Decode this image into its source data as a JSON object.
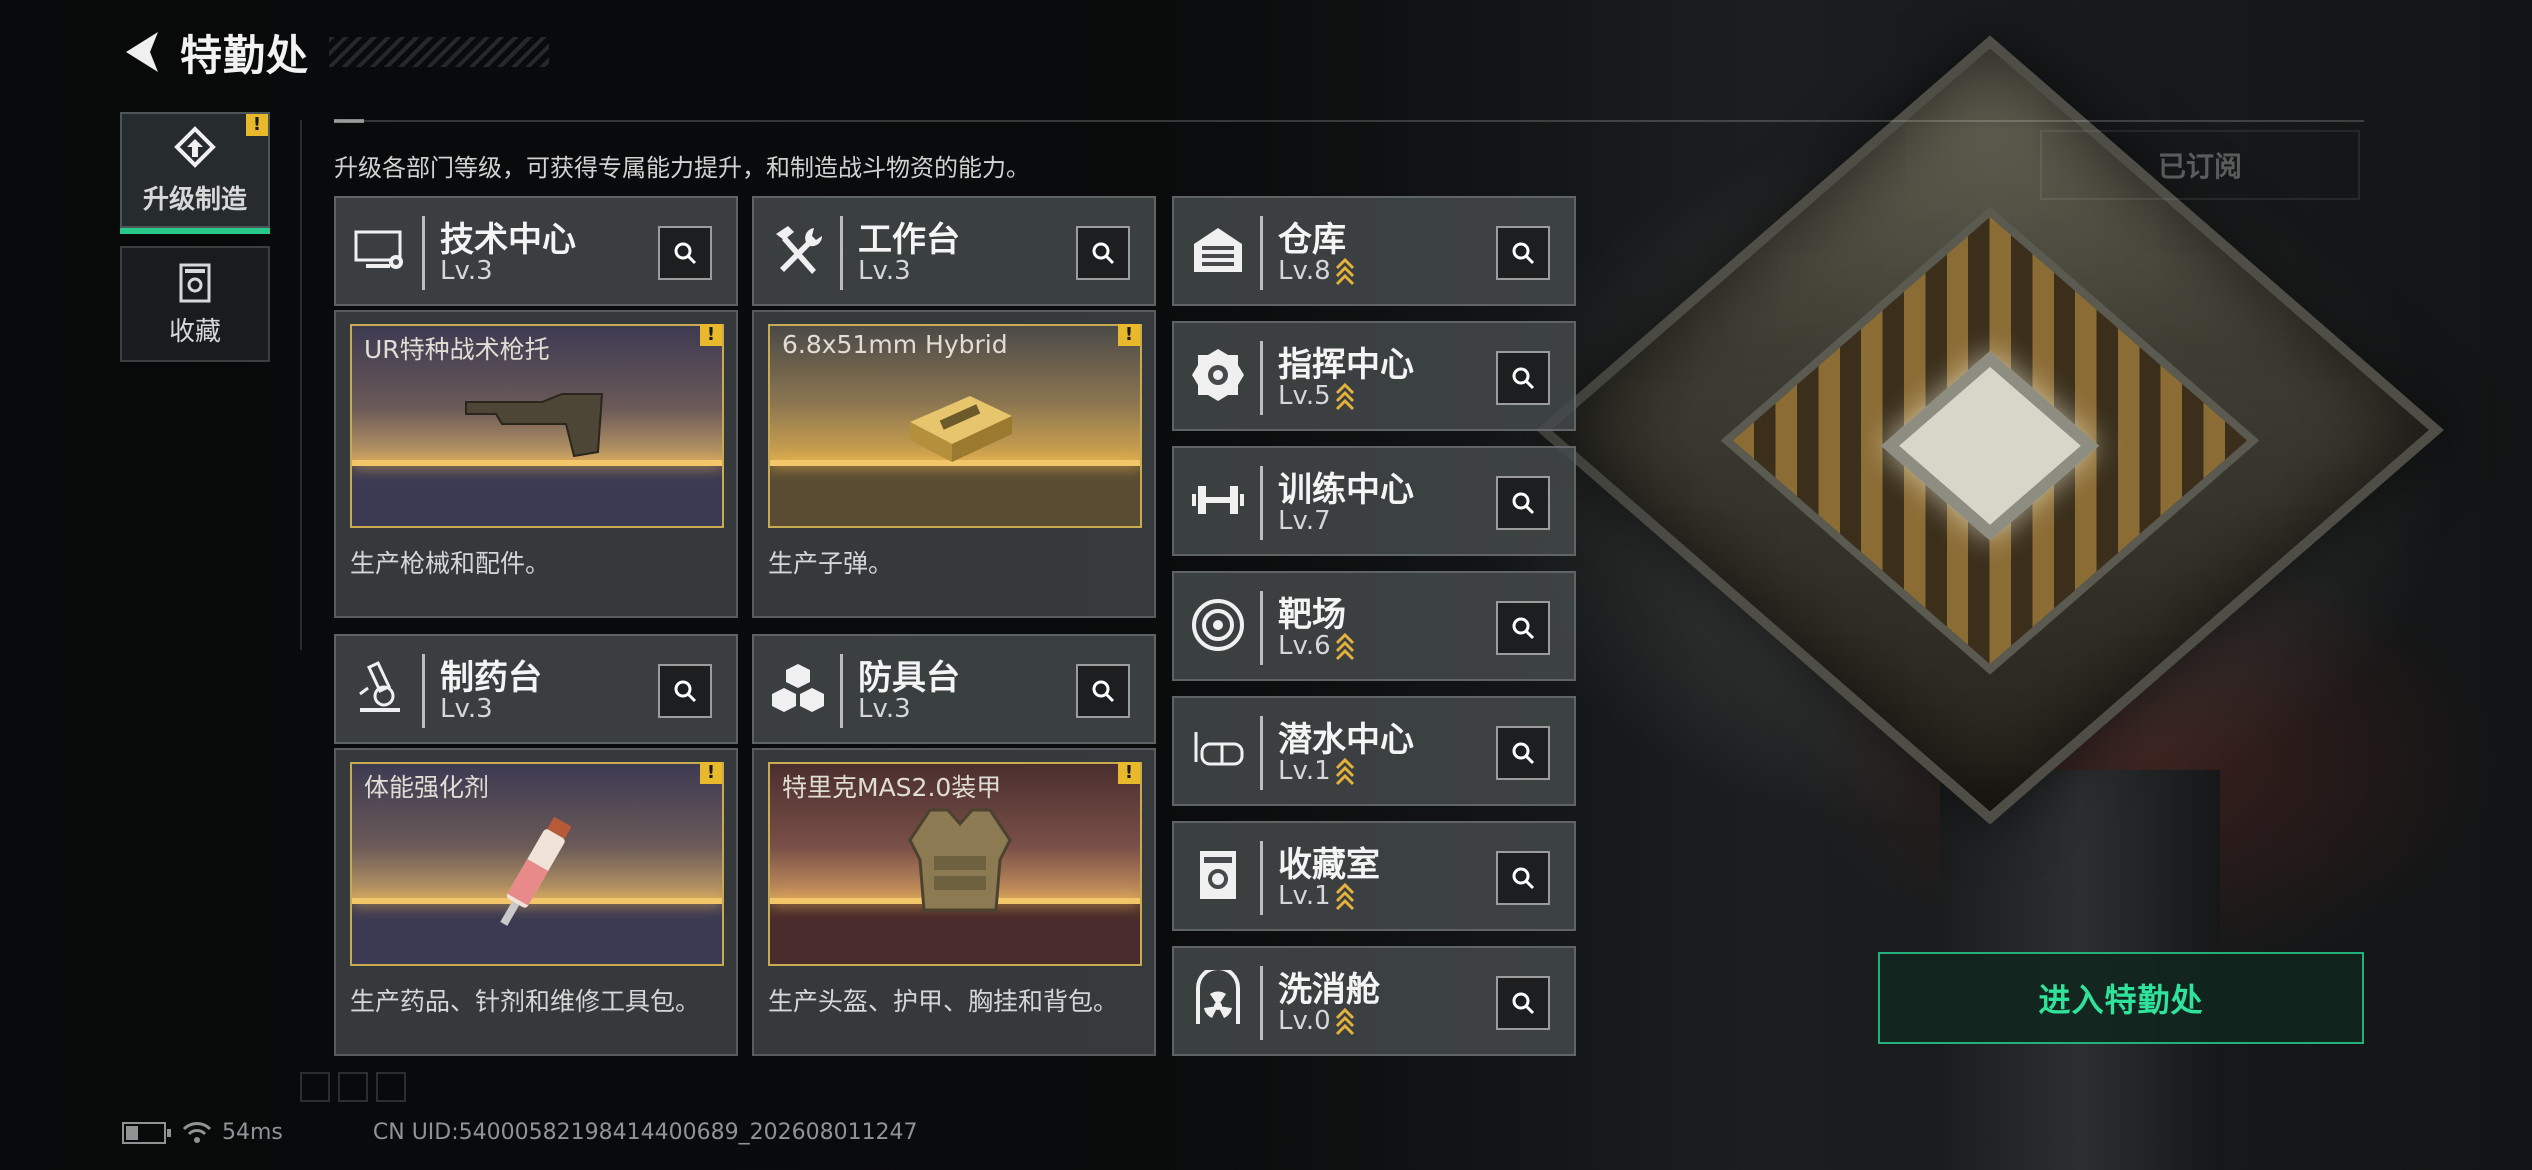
{
  "header": {
    "title": "特勤处"
  },
  "sidebar": {
    "tabs": [
      {
        "label": "升级制造",
        "active": true,
        "warning": "!"
      },
      {
        "label": "收藏",
        "active": false
      }
    ]
  },
  "intro_text": "升级各部门等级，可获得专属能力提升，和制造战斗物资的能力。",
  "subscribed_label": "已订阅",
  "workshops": [
    {
      "name": "技术中心",
      "level": "Lv.3",
      "icon": "monitor-gear-icon",
      "product": {
        "name": "UR特种战术枪托",
        "warning": "!",
        "description": "生产枪械和配件。",
        "theme": "purple-gold"
      }
    },
    {
      "name": "工作台",
      "level": "Lv.3",
      "icon": "tools-icon",
      "product": {
        "name": "6.8x51mm Hybrid",
        "warning": "!",
        "description": "生产子弹。",
        "theme": "gold"
      }
    },
    {
      "name": "制药台",
      "level": "Lv.3",
      "icon": "microscope-icon",
      "product": {
        "name": "体能强化剂",
        "warning": "!",
        "description": "生产药品、针剂和维修工具包。",
        "theme": "purple-gold"
      }
    },
    {
      "name": "防具台",
      "level": "Lv.3",
      "icon": "armor-blocks-icon",
      "product": {
        "name": "特里克MAS2.0装甲",
        "warning": "!",
        "description": "生产头盔、护甲、胸挂和背包。",
        "theme": "red-gold"
      }
    }
  ],
  "facilities": [
    {
      "name": "仓库",
      "level": "Lv.8",
      "upgradeable": true,
      "icon": "warehouse-icon"
    },
    {
      "name": "指挥中心",
      "level": "Lv.5",
      "upgradeable": true,
      "icon": "chip-icon"
    },
    {
      "name": "训练中心",
      "level": "Lv.7",
      "upgradeable": false,
      "icon": "dumbbell-icon"
    },
    {
      "name": "靶场",
      "level": "Lv.6",
      "upgradeable": true,
      "icon": "target-icon"
    },
    {
      "name": "潜水中心",
      "level": "Lv.1",
      "upgradeable": true,
      "icon": "diving-mask-icon"
    },
    {
      "name": "收藏室",
      "level": "Lv.1",
      "upgradeable": true,
      "icon": "collection-icon"
    },
    {
      "name": "洗消舱",
      "level": "Lv.0",
      "upgradeable": true,
      "icon": "radiation-icon"
    }
  ],
  "enter_button": "进入特勤处",
  "footer": {
    "ping": "54ms",
    "uid": "CN UID:54000582198414400689_202608011247"
  },
  "colors": {
    "accent_green": "#2fe39a",
    "warning_yellow": "#e8b92b",
    "gold_frame": "#c8aa52"
  }
}
